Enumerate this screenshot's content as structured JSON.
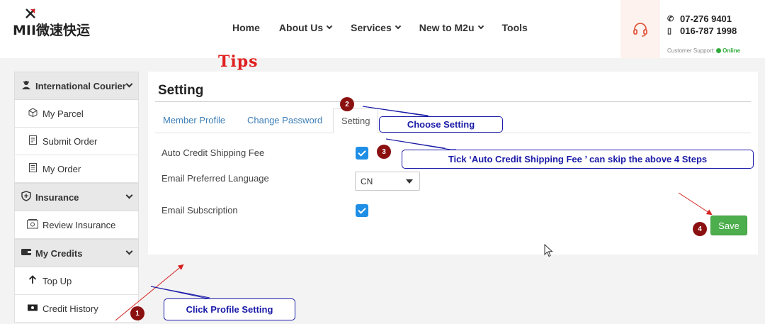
{
  "header": {
    "brand_text": "MII微速快运",
    "nav": [
      {
        "label": "Home",
        "has_dropdown": false
      },
      {
        "label": "About Us",
        "has_dropdown": true
      },
      {
        "label": "Services",
        "has_dropdown": true
      },
      {
        "label": "New to M2u",
        "has_dropdown": true
      },
      {
        "label": "Tools",
        "has_dropdown": false
      }
    ],
    "support_icon": "headset-icon",
    "phone1": "07-276 9401",
    "phone2": "016-787 1998",
    "support_label": "Customer Support:",
    "support_status": "Online"
  },
  "tips_label": "Tips",
  "sidebar": {
    "sections": [
      {
        "label": "International Courier",
        "icon": "courier-icon",
        "items": [
          {
            "label": "My Parcel",
            "icon": "parcel-icon"
          },
          {
            "label": "Submit Order",
            "icon": "submit-order-icon"
          },
          {
            "label": "My Order",
            "icon": "order-icon"
          }
        ]
      },
      {
        "label": "Insurance",
        "icon": "shield-icon",
        "items": [
          {
            "label": "Review Insurance",
            "icon": "review-insurance-icon"
          }
        ]
      },
      {
        "label": "My Credits",
        "icon": "wallet-icon",
        "items": [
          {
            "label": "Top Up",
            "icon": "arrow-up-icon"
          },
          {
            "label": "Credit History",
            "icon": "cash-icon"
          }
        ]
      }
    ]
  },
  "main": {
    "title": "Setting",
    "tabs": [
      {
        "label": "Member Profile",
        "active": false
      },
      {
        "label": "Change Password",
        "active": false
      },
      {
        "label": "Setting",
        "active": true
      }
    ],
    "fields": {
      "auto_credit": {
        "label": "Auto Credit Shipping Fee",
        "checked": true
      },
      "language": {
        "label": "Email Preferred Language",
        "value": "CN"
      },
      "subscription": {
        "label": "Email Subscription",
        "checked": true
      }
    },
    "save_label": "Save"
  },
  "annotations": {
    "step1": {
      "num": "1",
      "text": "Click Profile Setting"
    },
    "step2": {
      "num": "2",
      "text": "Choose Setting"
    },
    "step3": {
      "num": "3",
      "text": "Tick ‘Auto Credit Shipping Fee ’ can skip the above 4 Steps"
    },
    "step4": {
      "num": "4"
    }
  },
  "colors": {
    "accent_blue": "#3d7fb8",
    "checkbox_blue": "#1e8ee6",
    "save_green": "#4cae4c",
    "tips_red": "#e02020",
    "annotation_blue": "#1a1aa8",
    "step_badge": "#8b1010",
    "online_green": "#2eaa3a"
  }
}
